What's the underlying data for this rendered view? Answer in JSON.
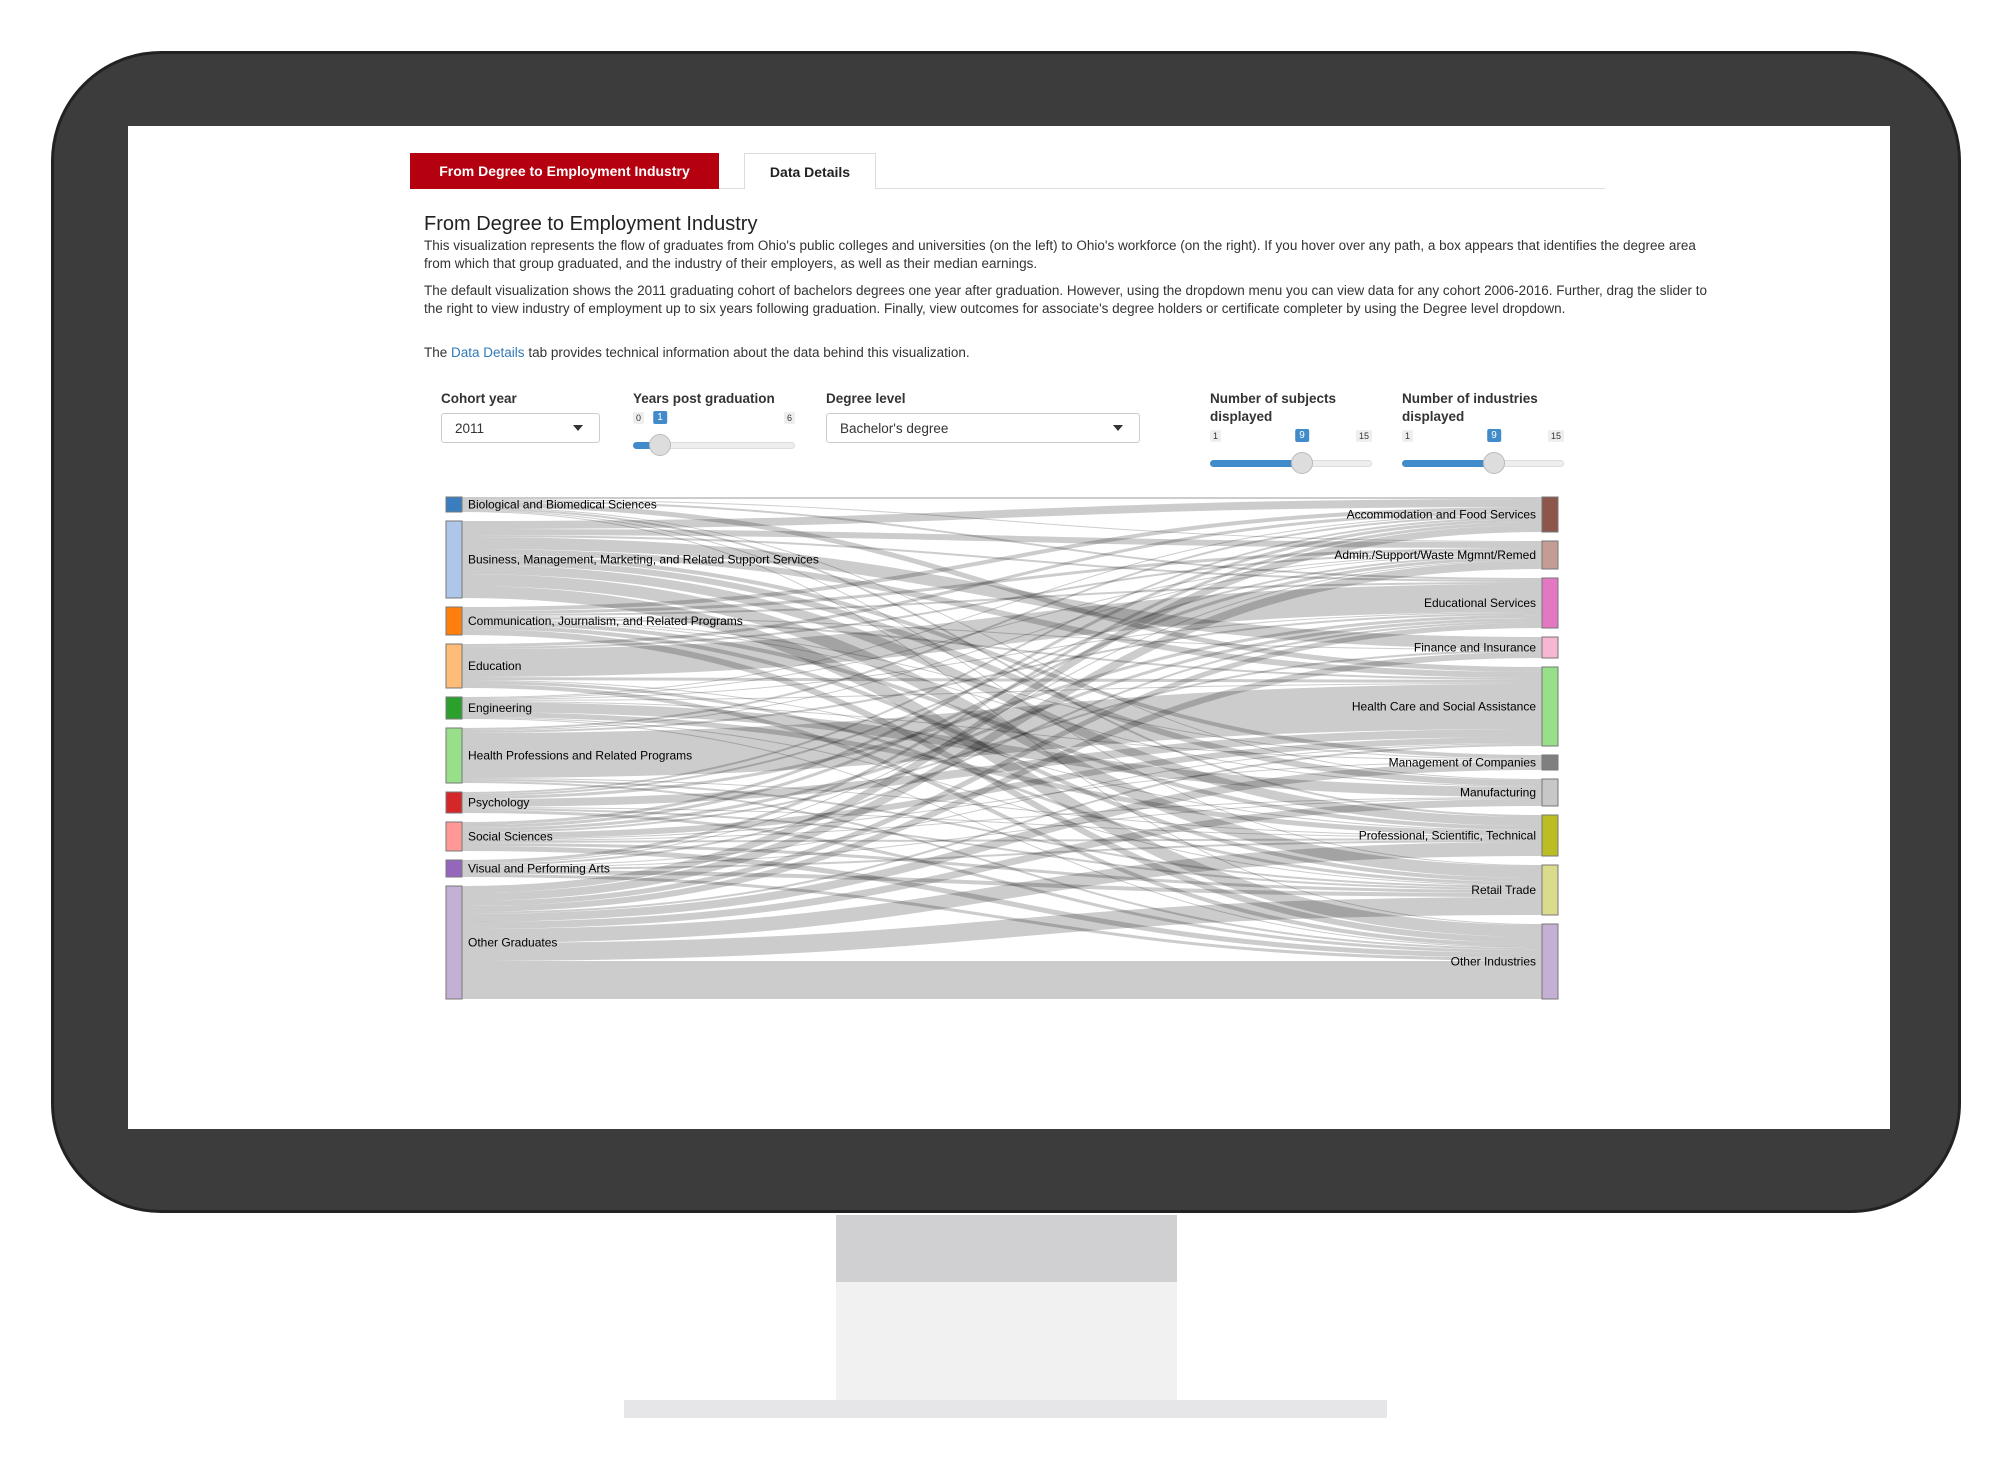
{
  "tabs": [
    {
      "label": "From Degree to Employment Industry",
      "active": true
    },
    {
      "label": "Data Details",
      "active": false
    }
  ],
  "title": "From Degree to Employment Industry",
  "paragraphs": {
    "p1": "This visualization represents the flow of graduates from Ohio's public colleges and universities (on the left) to Ohio's workforce (on the right). If you hover over any path, a box appears that identifies the degree area from which that group graduated, and the industry of their employers, as well as their median earnings.",
    "p2": "The default visualization shows the 2011 graduating cohort of bachelors degrees one year after graduation. However, using the dropdown menu you can view data for any cohort 2006-2016. Further, drag the slider to the right to view industry of employment up to six years following graduation. Finally, view outcomes for associate's degree holders or certificate completer by using the Degree level dropdown.",
    "p3_pre": "The ",
    "p3_link": "Data Details",
    "p3_post": " tab provides technical information about the data behind this visualization."
  },
  "controls": {
    "cohort": {
      "label": "Cohort year",
      "value": "2011"
    },
    "years": {
      "label": "Years post graduation",
      "min": "0",
      "max": "6",
      "value": "1"
    },
    "degree": {
      "label": "Degree level",
      "value": "Bachelor's degree"
    },
    "subjects": {
      "label1": "Number of subjects",
      "label2": "displayed",
      "min": "1",
      "max": "15",
      "value": "9"
    },
    "industries": {
      "label1": "Number of industries",
      "label2": "displayed",
      "min": "1",
      "max": "15",
      "value": "9"
    }
  },
  "chart_data": {
    "type": "sankey",
    "sources": [
      {
        "name": "Biological and Biomedical Sciences",
        "color": "#3a7ebf"
      },
      {
        "name": "Business, Management, Marketing, and Related Support Services",
        "color": "#aec7e8"
      },
      {
        "name": "Communication, Journalism, and Related Programs",
        "color": "#ff7f0e"
      },
      {
        "name": "Education",
        "color": "#ffbb78"
      },
      {
        "name": "Engineering",
        "color": "#2ca02c"
      },
      {
        "name": "Health Professions and Related Programs",
        "color": "#98df8a"
      },
      {
        "name": "Psychology",
        "color": "#d62728"
      },
      {
        "name": "Social Sciences",
        "color": "#ff9896"
      },
      {
        "name": "Visual and Performing Arts",
        "color": "#9467bd"
      },
      {
        "name": "Other Graduates",
        "color": "#c5b0d5"
      }
    ],
    "targets": [
      {
        "name": "Accommodation and Food Services",
        "color": "#8c564b"
      },
      {
        "name": "Admin./Support/Waste Mgmnt/Remed",
        "color": "#c49c94"
      },
      {
        "name": "Educational Services",
        "color": "#e377c2"
      },
      {
        "name": "Finance and Insurance",
        "color": "#f7b6d2"
      },
      {
        "name": "Health Care and Social Assistance",
        "color": "#98df8a"
      },
      {
        "name": "Management of Companies",
        "color": "#7f7f7f"
      },
      {
        "name": "Manufacturing",
        "color": "#c7c7c7"
      },
      {
        "name": "Professional, Scientific, Technical",
        "color": "#bcbd22"
      },
      {
        "name": "Retail Trade",
        "color": "#dbdb8d"
      },
      {
        "name": "Other Industries",
        "color": "#c5b0d5"
      }
    ],
    "flows": [
      [
        2,
        1,
        2,
        0,
        5,
        0,
        1,
        2,
        1,
        1
      ],
      [
        8,
        6,
        2,
        12,
        6,
        4,
        6,
        9,
        12,
        12
      ],
      [
        4,
        3,
        2,
        1,
        2,
        1,
        1,
        4,
        4,
        6
      ],
      [
        3,
        2,
        28,
        0,
        3,
        0,
        0,
        1,
        3,
        4
      ],
      [
        1,
        1,
        1,
        0,
        1,
        1,
        10,
        5,
        1,
        1
      ],
      [
        2,
        1,
        2,
        0,
        45,
        0,
        0,
        1,
        2,
        2
      ],
      [
        2,
        2,
        3,
        0,
        8,
        0,
        0,
        1,
        2,
        3
      ],
      [
        3,
        3,
        3,
        2,
        6,
        1,
        1,
        2,
        3,
        5
      ],
      [
        3,
        1,
        2,
        0,
        1,
        0,
        1,
        2,
        4,
        3
      ],
      [
        7,
        8,
        5,
        6,
        2,
        8,
        7,
        14,
        18,
        38
      ]
    ],
    "link_color": "#000000"
  }
}
